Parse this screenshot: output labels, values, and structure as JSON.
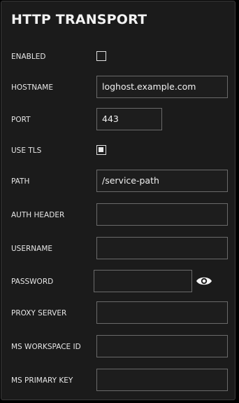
{
  "panel": {
    "title": "HTTP TRANSPORT"
  },
  "fields": {
    "enabled": {
      "label": "ENABLED",
      "checked": false
    },
    "hostname": {
      "label": "HOSTNAME",
      "value": "loghost.example.com"
    },
    "port": {
      "label": "PORT",
      "value": "443"
    },
    "use_tls": {
      "label": "USE TLS",
      "checked": true
    },
    "path": {
      "label": "PATH",
      "value": "/service-path"
    },
    "auth_header": {
      "label": "AUTH HEADER",
      "value": ""
    },
    "username": {
      "label": "USERNAME",
      "value": ""
    },
    "password": {
      "label": "PASSWORD",
      "value": "",
      "toggle_icon": "eye-icon"
    },
    "proxy_server": {
      "label": "PROXY SERVER",
      "value": ""
    },
    "ms_workspace_id": {
      "label": "MS WORKSPACE ID",
      "value": ""
    },
    "ms_primary_key": {
      "label": "MS PRIMARY KEY",
      "value": ""
    }
  },
  "colors": {
    "background": "#1b1b1b",
    "text": "#f2f2f2",
    "input_border": "#6a6a6a"
  }
}
